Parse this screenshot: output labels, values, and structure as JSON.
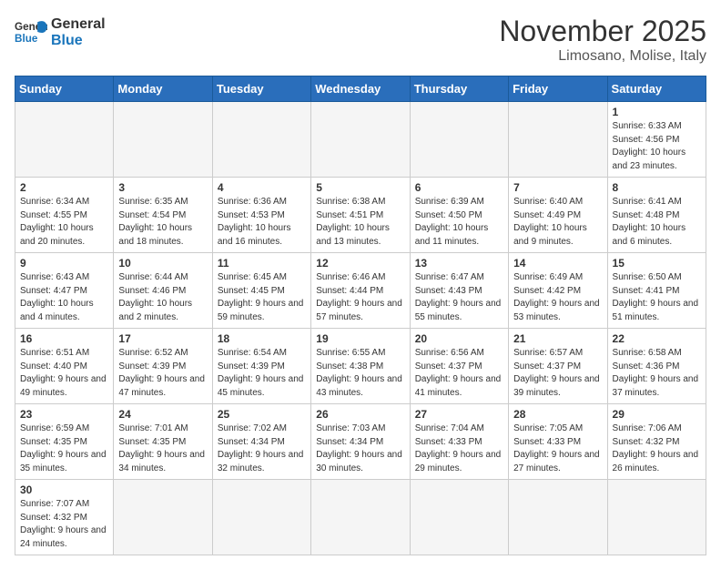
{
  "header": {
    "logo_general": "General",
    "logo_blue": "Blue",
    "title": "November 2025",
    "subtitle": "Limosano, Molise, Italy"
  },
  "days_of_week": [
    "Sunday",
    "Monday",
    "Tuesday",
    "Wednesday",
    "Thursday",
    "Friday",
    "Saturday"
  ],
  "weeks": [
    [
      {
        "day": "",
        "info": ""
      },
      {
        "day": "",
        "info": ""
      },
      {
        "day": "",
        "info": ""
      },
      {
        "day": "",
        "info": ""
      },
      {
        "day": "",
        "info": ""
      },
      {
        "day": "",
        "info": ""
      },
      {
        "day": "1",
        "info": "Sunrise: 6:33 AM\nSunset: 4:56 PM\nDaylight: 10 hours and 23 minutes."
      }
    ],
    [
      {
        "day": "2",
        "info": "Sunrise: 6:34 AM\nSunset: 4:55 PM\nDaylight: 10 hours and 20 minutes."
      },
      {
        "day": "3",
        "info": "Sunrise: 6:35 AM\nSunset: 4:54 PM\nDaylight: 10 hours and 18 minutes."
      },
      {
        "day": "4",
        "info": "Sunrise: 6:36 AM\nSunset: 4:53 PM\nDaylight: 10 hours and 16 minutes."
      },
      {
        "day": "5",
        "info": "Sunrise: 6:38 AM\nSunset: 4:51 PM\nDaylight: 10 hours and 13 minutes."
      },
      {
        "day": "6",
        "info": "Sunrise: 6:39 AM\nSunset: 4:50 PM\nDaylight: 10 hours and 11 minutes."
      },
      {
        "day": "7",
        "info": "Sunrise: 6:40 AM\nSunset: 4:49 PM\nDaylight: 10 hours and 9 minutes."
      },
      {
        "day": "8",
        "info": "Sunrise: 6:41 AM\nSunset: 4:48 PM\nDaylight: 10 hours and 6 minutes."
      }
    ],
    [
      {
        "day": "9",
        "info": "Sunrise: 6:43 AM\nSunset: 4:47 PM\nDaylight: 10 hours and 4 minutes."
      },
      {
        "day": "10",
        "info": "Sunrise: 6:44 AM\nSunset: 4:46 PM\nDaylight: 10 hours and 2 minutes."
      },
      {
        "day": "11",
        "info": "Sunrise: 6:45 AM\nSunset: 4:45 PM\nDaylight: 9 hours and 59 minutes."
      },
      {
        "day": "12",
        "info": "Sunrise: 6:46 AM\nSunset: 4:44 PM\nDaylight: 9 hours and 57 minutes."
      },
      {
        "day": "13",
        "info": "Sunrise: 6:47 AM\nSunset: 4:43 PM\nDaylight: 9 hours and 55 minutes."
      },
      {
        "day": "14",
        "info": "Sunrise: 6:49 AM\nSunset: 4:42 PM\nDaylight: 9 hours and 53 minutes."
      },
      {
        "day": "15",
        "info": "Sunrise: 6:50 AM\nSunset: 4:41 PM\nDaylight: 9 hours and 51 minutes."
      }
    ],
    [
      {
        "day": "16",
        "info": "Sunrise: 6:51 AM\nSunset: 4:40 PM\nDaylight: 9 hours and 49 minutes."
      },
      {
        "day": "17",
        "info": "Sunrise: 6:52 AM\nSunset: 4:39 PM\nDaylight: 9 hours and 47 minutes."
      },
      {
        "day": "18",
        "info": "Sunrise: 6:54 AM\nSunset: 4:39 PM\nDaylight: 9 hours and 45 minutes."
      },
      {
        "day": "19",
        "info": "Sunrise: 6:55 AM\nSunset: 4:38 PM\nDaylight: 9 hours and 43 minutes."
      },
      {
        "day": "20",
        "info": "Sunrise: 6:56 AM\nSunset: 4:37 PM\nDaylight: 9 hours and 41 minutes."
      },
      {
        "day": "21",
        "info": "Sunrise: 6:57 AM\nSunset: 4:37 PM\nDaylight: 9 hours and 39 minutes."
      },
      {
        "day": "22",
        "info": "Sunrise: 6:58 AM\nSunset: 4:36 PM\nDaylight: 9 hours and 37 minutes."
      }
    ],
    [
      {
        "day": "23",
        "info": "Sunrise: 6:59 AM\nSunset: 4:35 PM\nDaylight: 9 hours and 35 minutes."
      },
      {
        "day": "24",
        "info": "Sunrise: 7:01 AM\nSunset: 4:35 PM\nDaylight: 9 hours and 34 minutes."
      },
      {
        "day": "25",
        "info": "Sunrise: 7:02 AM\nSunset: 4:34 PM\nDaylight: 9 hours and 32 minutes."
      },
      {
        "day": "26",
        "info": "Sunrise: 7:03 AM\nSunset: 4:34 PM\nDaylight: 9 hours and 30 minutes."
      },
      {
        "day": "27",
        "info": "Sunrise: 7:04 AM\nSunset: 4:33 PM\nDaylight: 9 hours and 29 minutes."
      },
      {
        "day": "28",
        "info": "Sunrise: 7:05 AM\nSunset: 4:33 PM\nDaylight: 9 hours and 27 minutes."
      },
      {
        "day": "29",
        "info": "Sunrise: 7:06 AM\nSunset: 4:32 PM\nDaylight: 9 hours and 26 minutes."
      }
    ],
    [
      {
        "day": "30",
        "info": "Sunrise: 7:07 AM\nSunset: 4:32 PM\nDaylight: 9 hours and 24 minutes."
      },
      {
        "day": "",
        "info": ""
      },
      {
        "day": "",
        "info": ""
      },
      {
        "day": "",
        "info": ""
      },
      {
        "day": "",
        "info": ""
      },
      {
        "day": "",
        "info": ""
      },
      {
        "day": "",
        "info": ""
      }
    ]
  ]
}
